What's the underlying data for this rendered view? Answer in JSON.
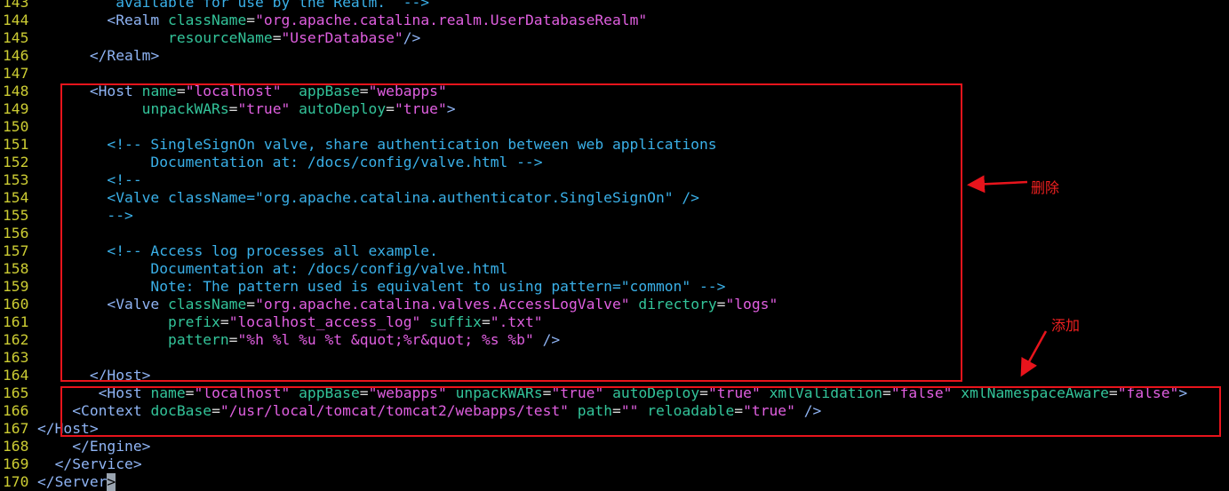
{
  "editor": {
    "lines": [
      {
        "num": "143",
        "segments": [
          {
            "t": "         available for use by the Realm.  -->",
            "c": "cmt"
          }
        ]
      },
      {
        "num": "144",
        "segments": [
          {
            "t": "        ",
            "c": "txt"
          },
          {
            "t": "<Realm ",
            "c": "tag"
          },
          {
            "t": "className",
            "c": "attr"
          },
          {
            "t": "=",
            "c": "txt"
          },
          {
            "t": "\"org.apache.catalina.realm.UserDatabaseRealm\"",
            "c": "str"
          }
        ]
      },
      {
        "num": "145",
        "segments": [
          {
            "t": "               ",
            "c": "txt"
          },
          {
            "t": "resourceName",
            "c": "attr"
          },
          {
            "t": "=",
            "c": "txt"
          },
          {
            "t": "\"UserDatabase\"",
            "c": "str"
          },
          {
            "t": "/>",
            "c": "tag"
          }
        ]
      },
      {
        "num": "146",
        "segments": [
          {
            "t": "      ",
            "c": "txt"
          },
          {
            "t": "</Realm>",
            "c": "tag"
          }
        ]
      },
      {
        "num": "147",
        "segments": []
      },
      {
        "num": "148",
        "segments": [
          {
            "t": "      ",
            "c": "txt"
          },
          {
            "t": "<Host ",
            "c": "tag"
          },
          {
            "t": "name",
            "c": "attr"
          },
          {
            "t": "=",
            "c": "txt"
          },
          {
            "t": "\"localhost\"",
            "c": "str"
          },
          {
            "t": "  ",
            "c": "txt"
          },
          {
            "t": "appBase",
            "c": "attr"
          },
          {
            "t": "=",
            "c": "txt"
          },
          {
            "t": "\"webapps\"",
            "c": "str"
          }
        ]
      },
      {
        "num": "149",
        "segments": [
          {
            "t": "            ",
            "c": "txt"
          },
          {
            "t": "unpackWARs",
            "c": "attr"
          },
          {
            "t": "=",
            "c": "txt"
          },
          {
            "t": "\"true\"",
            "c": "str"
          },
          {
            "t": " ",
            "c": "txt"
          },
          {
            "t": "autoDeploy",
            "c": "attr"
          },
          {
            "t": "=",
            "c": "txt"
          },
          {
            "t": "\"true\"",
            "c": "str"
          },
          {
            "t": ">",
            "c": "tag"
          }
        ]
      },
      {
        "num": "150",
        "segments": []
      },
      {
        "num": "151",
        "segments": [
          {
            "t": "        ",
            "c": "txt"
          },
          {
            "t": "<!-- SingleSignOn valve, share authentication between web applications",
            "c": "cmt"
          }
        ]
      },
      {
        "num": "152",
        "segments": [
          {
            "t": "             Documentation at: /docs/config/valve.html -->",
            "c": "cmt"
          }
        ]
      },
      {
        "num": "153",
        "segments": [
          {
            "t": "        ",
            "c": "txt"
          },
          {
            "t": "<!--",
            "c": "cmt"
          }
        ]
      },
      {
        "num": "154",
        "segments": [
          {
            "t": "        <Valve className=\"org.apache.catalina.authenticator.SingleSignOn\" />",
            "c": "cmt"
          }
        ]
      },
      {
        "num": "155",
        "segments": [
          {
            "t": "        -->",
            "c": "cmt"
          }
        ]
      },
      {
        "num": "156",
        "segments": []
      },
      {
        "num": "157",
        "segments": [
          {
            "t": "        ",
            "c": "txt"
          },
          {
            "t": "<!-- Access log processes all example.",
            "c": "cmt"
          }
        ]
      },
      {
        "num": "158",
        "segments": [
          {
            "t": "             Documentation at: /docs/config/valve.html",
            "c": "cmt"
          }
        ]
      },
      {
        "num": "159",
        "segments": [
          {
            "t": "             Note: The pattern used is equivalent to using pattern=\"common\" -->",
            "c": "cmt"
          }
        ]
      },
      {
        "num": "160",
        "segments": [
          {
            "t": "        ",
            "c": "txt"
          },
          {
            "t": "<Valve ",
            "c": "tag"
          },
          {
            "t": "className",
            "c": "attr"
          },
          {
            "t": "=",
            "c": "txt"
          },
          {
            "t": "\"org.apache.catalina.valves.AccessLogValve\"",
            "c": "str"
          },
          {
            "t": " ",
            "c": "txt"
          },
          {
            "t": "directory",
            "c": "attr"
          },
          {
            "t": "=",
            "c": "txt"
          },
          {
            "t": "\"logs\"",
            "c": "str"
          }
        ]
      },
      {
        "num": "161",
        "segments": [
          {
            "t": "               ",
            "c": "txt"
          },
          {
            "t": "prefix",
            "c": "attr"
          },
          {
            "t": "=",
            "c": "txt"
          },
          {
            "t": "\"localhost_access_log\"",
            "c": "str"
          },
          {
            "t": " ",
            "c": "txt"
          },
          {
            "t": "suffix",
            "c": "attr"
          },
          {
            "t": "=",
            "c": "txt"
          },
          {
            "t": "\".txt\"",
            "c": "str"
          }
        ]
      },
      {
        "num": "162",
        "segments": [
          {
            "t": "               ",
            "c": "txt"
          },
          {
            "t": "pattern",
            "c": "attr"
          },
          {
            "t": "=",
            "c": "txt"
          },
          {
            "t": "\"%h %l %u %t &quot;%r&quot; %s %b\"",
            "c": "str"
          },
          {
            "t": " />",
            "c": "tag"
          }
        ]
      },
      {
        "num": "163",
        "segments": []
      },
      {
        "num": "164",
        "segments": [
          {
            "t": "      ",
            "c": "txt"
          },
          {
            "t": "</Host>",
            "c": "tag"
          }
        ]
      },
      {
        "num": "165",
        "segments": [
          {
            "t": "       ",
            "c": "txt"
          },
          {
            "t": "<Host ",
            "c": "tag"
          },
          {
            "t": "name",
            "c": "attr"
          },
          {
            "t": "=",
            "c": "txt"
          },
          {
            "t": "\"localhost\"",
            "c": "str"
          },
          {
            "t": " ",
            "c": "txt"
          },
          {
            "t": "appBase",
            "c": "attr"
          },
          {
            "t": "=",
            "c": "txt"
          },
          {
            "t": "\"webapps\"",
            "c": "str"
          },
          {
            "t": " ",
            "c": "txt"
          },
          {
            "t": "unpackWARs",
            "c": "attr"
          },
          {
            "t": "=",
            "c": "txt"
          },
          {
            "t": "\"true\"",
            "c": "str"
          },
          {
            "t": " ",
            "c": "txt"
          },
          {
            "t": "autoDeploy",
            "c": "attr"
          },
          {
            "t": "=",
            "c": "txt"
          },
          {
            "t": "\"true\"",
            "c": "str"
          },
          {
            "t": " ",
            "c": "txt"
          },
          {
            "t": "xmlValidation",
            "c": "attr"
          },
          {
            "t": "=",
            "c": "txt"
          },
          {
            "t": "\"false\"",
            "c": "str"
          },
          {
            "t": " ",
            "c": "txt"
          },
          {
            "t": "xmlNamespaceAware",
            "c": "attr"
          },
          {
            "t": "=",
            "c": "txt"
          },
          {
            "t": "\"false\"",
            "c": "str"
          },
          {
            "t": ">",
            "c": "tag"
          }
        ]
      },
      {
        "num": "166",
        "segments": [
          {
            "t": "    ",
            "c": "txt"
          },
          {
            "t": "<Context ",
            "c": "tag"
          },
          {
            "t": "docBase",
            "c": "attr"
          },
          {
            "t": "=",
            "c": "txt"
          },
          {
            "t": "\"/usr/local/tomcat/tomcat2/webapps/test\"",
            "c": "str"
          },
          {
            "t": " ",
            "c": "txt"
          },
          {
            "t": "path",
            "c": "attr"
          },
          {
            "t": "=",
            "c": "txt"
          },
          {
            "t": "\"\"",
            "c": "str"
          },
          {
            "t": " ",
            "c": "txt"
          },
          {
            "t": "reloadable",
            "c": "attr"
          },
          {
            "t": "=",
            "c": "txt"
          },
          {
            "t": "\"true\"",
            "c": "str"
          },
          {
            "t": " />",
            "c": "tag"
          }
        ]
      },
      {
        "num": "167",
        "segments": [
          {
            "t": "</Host>",
            "c": "tag"
          }
        ]
      },
      {
        "num": "168",
        "segments": [
          {
            "t": "    ",
            "c": "txt"
          },
          {
            "t": "</Engine>",
            "c": "tag"
          }
        ]
      },
      {
        "num": "169",
        "segments": [
          {
            "t": "  ",
            "c": "txt"
          },
          {
            "t": "</Service>",
            "c": "tag"
          }
        ]
      },
      {
        "num": "170",
        "segments": [
          {
            "t": "</Server",
            "c": "tag"
          },
          {
            "t": ">",
            "c": "cursor"
          }
        ]
      }
    ]
  },
  "annotations": {
    "delete_label": "删除",
    "add_label": "添加",
    "color": "#e8141c"
  }
}
